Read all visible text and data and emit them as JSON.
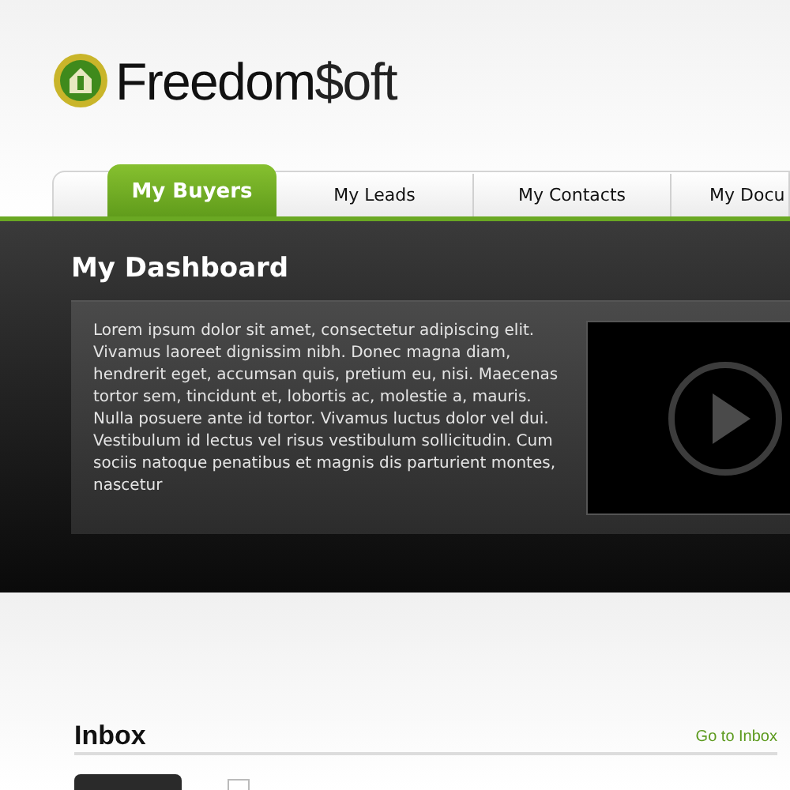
{
  "logo": {
    "text_1": "Freedom",
    "text_2": "$oft"
  },
  "tabs": [
    {
      "label": "My Buyers",
      "selected": true
    },
    {
      "label": "My Leads",
      "selected": false
    },
    {
      "label": "My Contacts",
      "selected": false
    },
    {
      "label": "My Docu",
      "selected": false
    }
  ],
  "dashboard": {
    "title": "My Dashboard",
    "body": "Lorem ipsum dolor sit amet, consectetur adipiscing elit. Vivamus laoreet dignissim nibh. Donec magna diam, hendrerit eget, accumsan quis, pretium eu, nisi. Maecenas tortor sem, tincidunt et, lobortis ac, molestie a, mauris. Nulla posuere ante id tortor. Vivamus luctus dolor vel dui. Vestibulum id lectus vel risus vestibulum sollicitudin. Cum sociis natoque penatibus et magnis dis parturient montes, nascetur"
  },
  "inbox": {
    "title": "Inbox",
    "link": "Go to Inbox",
    "checkbox": {
      "checked": false
    }
  }
}
